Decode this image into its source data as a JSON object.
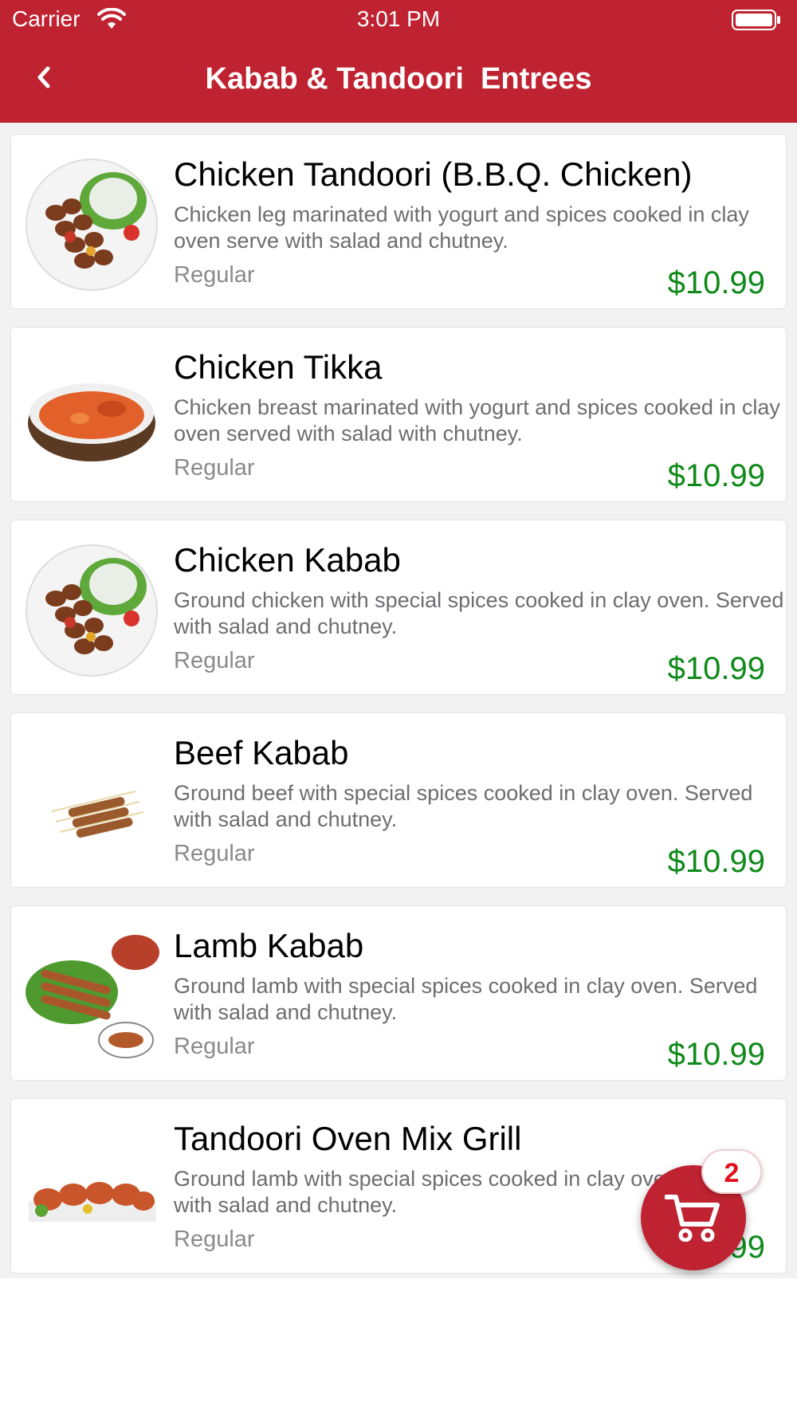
{
  "status_bar": {
    "carrier": "Carrier",
    "time": "3:01 PM"
  },
  "header": {
    "title": "Kabab & Tandoori  Entrees"
  },
  "items": [
    {
      "name": "Chicken Tandoori (B.B.Q. Chicken)",
      "description": "Chicken leg marinated with yogurt and spices cooked in clay oven serve with salad and chutney.",
      "size": "Regular",
      "price": "$10.99"
    },
    {
      "name": "Chicken Tikka",
      "description": "Chicken breast marinated with yogurt and spices cooked in clay oven served with salad with chutney.",
      "size": "Regular",
      "price": "$10.99"
    },
    {
      "name": "Chicken Kabab",
      "description": "Ground chicken with special spices cooked in clay oven. Served with salad and chutney.",
      "size": "Regular",
      "price": "$10.99"
    },
    {
      "name": "Beef Kabab",
      "description": "Ground beef with special spices cooked in clay oven. Served with salad and chutney.",
      "size": "Regular",
      "price": "$10.99"
    },
    {
      "name": "Lamb Kabab",
      "description": "Ground lamb with special spices cooked in clay oven. Served with salad and chutney.",
      "size": "Regular",
      "price": "$10.99"
    },
    {
      "name": "Tandoori Oven Mix Grill",
      "description": "Ground lamb with special spices cooked in clay oven. Served with salad and chutney.",
      "size": "Regular",
      "price": "$10.99"
    }
  ],
  "cart": {
    "count": "2",
    "icon": "cart-icon"
  },
  "colors": {
    "brand": "#bf2230",
    "price": "#0f8a1a"
  }
}
